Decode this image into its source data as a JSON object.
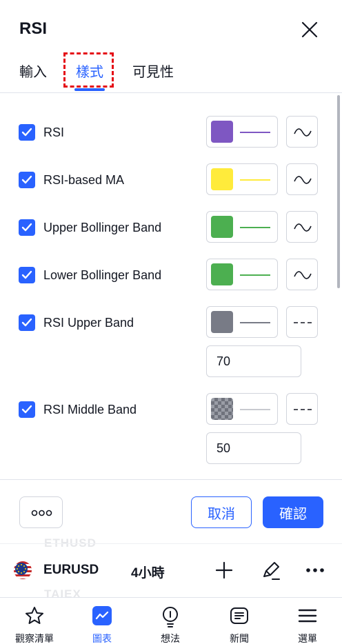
{
  "header": {
    "title": "RSI"
  },
  "tabs": [
    {
      "label": "輸入",
      "active": false
    },
    {
      "label": "樣式",
      "active": true
    },
    {
      "label": "可見性",
      "active": false
    }
  ],
  "rows": [
    {
      "label": "RSI",
      "checked": true,
      "color": "#7e57c2",
      "line": "#7e57c2",
      "style_icon": "curve-icon"
    },
    {
      "label": "RSI-based MA",
      "checked": true,
      "color": "#ffeb3b",
      "line": "#ffeb3b",
      "style_icon": "curve-icon"
    },
    {
      "label": "Upper Bollinger Band",
      "checked": true,
      "color": "#4caf50",
      "line": "#4caf50",
      "style_icon": "curve-icon"
    },
    {
      "label": "Lower Bollinger Band",
      "checked": true,
      "color": "#4caf50",
      "line": "#4caf50",
      "style_icon": "curve-icon"
    },
    {
      "label": "RSI Upper Band",
      "checked": true,
      "color": "#787b86",
      "line": "#787b86",
      "style_icon": "dashed-line-icon",
      "value": "70"
    },
    {
      "label": "RSI Middle Band",
      "checked": true,
      "color": "checkered",
      "line": "#c8cad0",
      "style_icon": "dashed-line-icon",
      "value": "50"
    }
  ],
  "footer": {
    "more_label": "more-options",
    "cancel_label": "取消",
    "ok_label": "確認"
  },
  "background_symbols": [
    "ETHUSD",
    "TAIEX"
  ],
  "symbol_bar": {
    "symbol": "EURUSD",
    "interval": "4小時"
  },
  "bottom_nav": [
    {
      "label": "觀察清單",
      "icon": "star-icon",
      "active": false
    },
    {
      "label": "圖表",
      "icon": "chart-icon",
      "active": true
    },
    {
      "label": "想法",
      "icon": "lightbulb-icon",
      "active": false
    },
    {
      "label": "新聞",
      "icon": "news-icon",
      "active": false
    },
    {
      "label": "選單",
      "icon": "menu-icon",
      "active": false
    }
  ],
  "colors": {
    "accent": "#2962ff",
    "highlight": "#e50914"
  }
}
